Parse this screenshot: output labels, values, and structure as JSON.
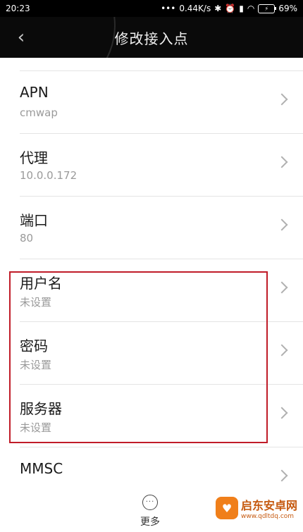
{
  "status_bar": {
    "time": "20:23",
    "network_speed": "0.44K/s",
    "battery": "69%"
  },
  "header": {
    "back_icon": "back-chevron-icon",
    "title": "修改接入点"
  },
  "settings": [
    {
      "label": "APN",
      "value": "cmwap"
    },
    {
      "label": "代理",
      "value": "10.0.0.172"
    },
    {
      "label": "端口",
      "value": "80"
    },
    {
      "label": "用户名",
      "value": "未设置"
    },
    {
      "label": "密码",
      "value": "未设置"
    },
    {
      "label": "服务器",
      "value": "未设置"
    },
    {
      "label": "MMSC",
      "value": ""
    }
  ],
  "bottom_bar": {
    "more_label": "更多"
  },
  "watermark": {
    "title": "启东安卓网",
    "url": "www.qdltdq.com"
  },
  "colors": {
    "highlight": "#c01c28",
    "title_bar": "#0a0a0a"
  }
}
